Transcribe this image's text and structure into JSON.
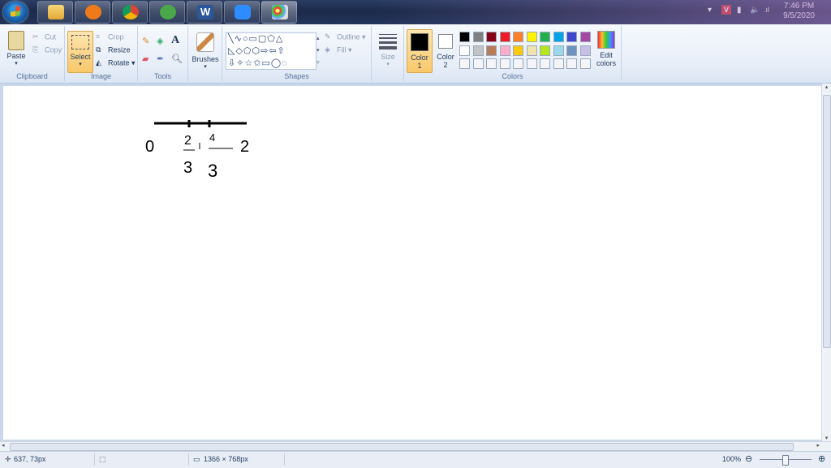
{
  "taskbar": {
    "apps": [
      "file-explorer",
      "media-player",
      "chrome",
      "app-green",
      "word",
      "zoom",
      "paint"
    ],
    "clock_time": "7:46 PM",
    "clock_date": "9/5/2020"
  },
  "ribbon": {
    "clipboard": {
      "paste": "Paste",
      "cut": "Cut",
      "copy": "Copy",
      "label": "Clipboard"
    },
    "image": {
      "select": "Select",
      "crop": "Crop",
      "resize": "Resize",
      "rotate": "Rotate",
      "label": "Image"
    },
    "tools": {
      "label": "Tools",
      "text_icon": "A"
    },
    "brushes": {
      "label": "Brushes"
    },
    "shapes": {
      "outline": "Outline",
      "fill": "Fill",
      "label": "Shapes"
    },
    "size": {
      "label": "Size"
    },
    "colors": {
      "color1": "Color",
      "color1_num": "1",
      "color2": "Color",
      "color2_num": "2",
      "edit": "Edit",
      "edit2": "colors",
      "label": "Colors",
      "color1_value": "#000000",
      "color2_value": "#ffffff",
      "palette_row1": [
        "#000000",
        "#7f7f7f",
        "#880015",
        "#ed1c24",
        "#ff7f27",
        "#fff200",
        "#22b14c",
        "#00a2e8",
        "#3f48cc",
        "#a349a4"
      ],
      "palette_row2": [
        "#ffffff",
        "#c3c3c3",
        "#b97a57",
        "#ffaec9",
        "#ffc90e",
        "#efe4b0",
        "#b5e61d",
        "#99d9ea",
        "#7092be",
        "#c8bfe7"
      ]
    }
  },
  "canvas": {
    "labels": {
      "zero": "0",
      "two_num": "2",
      "two_den": "3",
      "four_num": "4",
      "four_den": "3",
      "two": "2"
    }
  },
  "status": {
    "cursor_pos": "637, 73px",
    "image_size": "1366 × 768px",
    "zoom": "100%"
  }
}
